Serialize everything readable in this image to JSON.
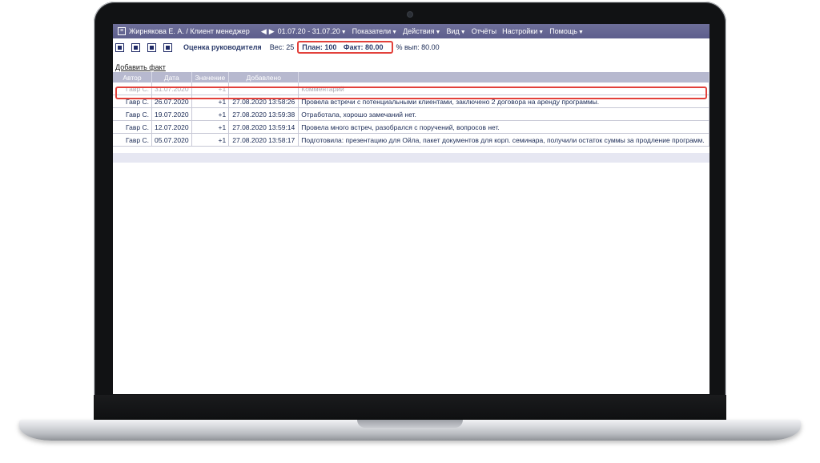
{
  "menubar": {
    "user": "Жирнякова Е. А. / Клиент менеджер",
    "period": "01.07.20 - 31.07.20",
    "items": [
      "Показатели",
      "Действия",
      "Вид",
      "Отчёты",
      "Настройки",
      "Помощь"
    ]
  },
  "toolbar": {
    "title": "Оценка руководителя",
    "weight": "Вес: 25",
    "plan": "План: 100",
    "fact": "Факт: 80.00",
    "percent": "% вып: 80.00"
  },
  "add_fact_link": "Добавить факт",
  "table": {
    "headers": [
      "Автор",
      "Дата",
      "Значение",
      "Добавлено",
      ""
    ],
    "input_row": {
      "author": "Гавр С.",
      "date": "31.07.2020",
      "value": "+1",
      "added": "",
      "comment": "Комментарий"
    },
    "rows": [
      {
        "author": "Гавр С.",
        "date": "26.07.2020",
        "value": "+1",
        "added": "27.08.2020 13:58:26",
        "comment": "Провела встречи с потенциальными клиентами, заключено 2 договора на аренду программы."
      },
      {
        "author": "Гавр С.",
        "date": "19.07.2020",
        "value": "+1",
        "added": "27.08.2020 13:59:38",
        "comment": "Отработала, хорошо замечаний нет."
      },
      {
        "author": "Гавр С.",
        "date": "12.07.2020",
        "value": "+1",
        "added": "27.08.2020 13:59:14",
        "comment": "Провела много встреч, разобрался с поручений, вопросов нет."
      },
      {
        "author": "Гавр С.",
        "date": "05.07.2020",
        "value": "+1",
        "added": "27.08.2020 13:58:17",
        "comment": "Подготовила: презентацию для Ойла, пакет документов для корп. семинара, получили остаток суммы за продление программ."
      }
    ]
  },
  "colors": {
    "menubar": "#5d5e8c",
    "header": "#b7b9cf",
    "highlight": "#e2413b"
  }
}
